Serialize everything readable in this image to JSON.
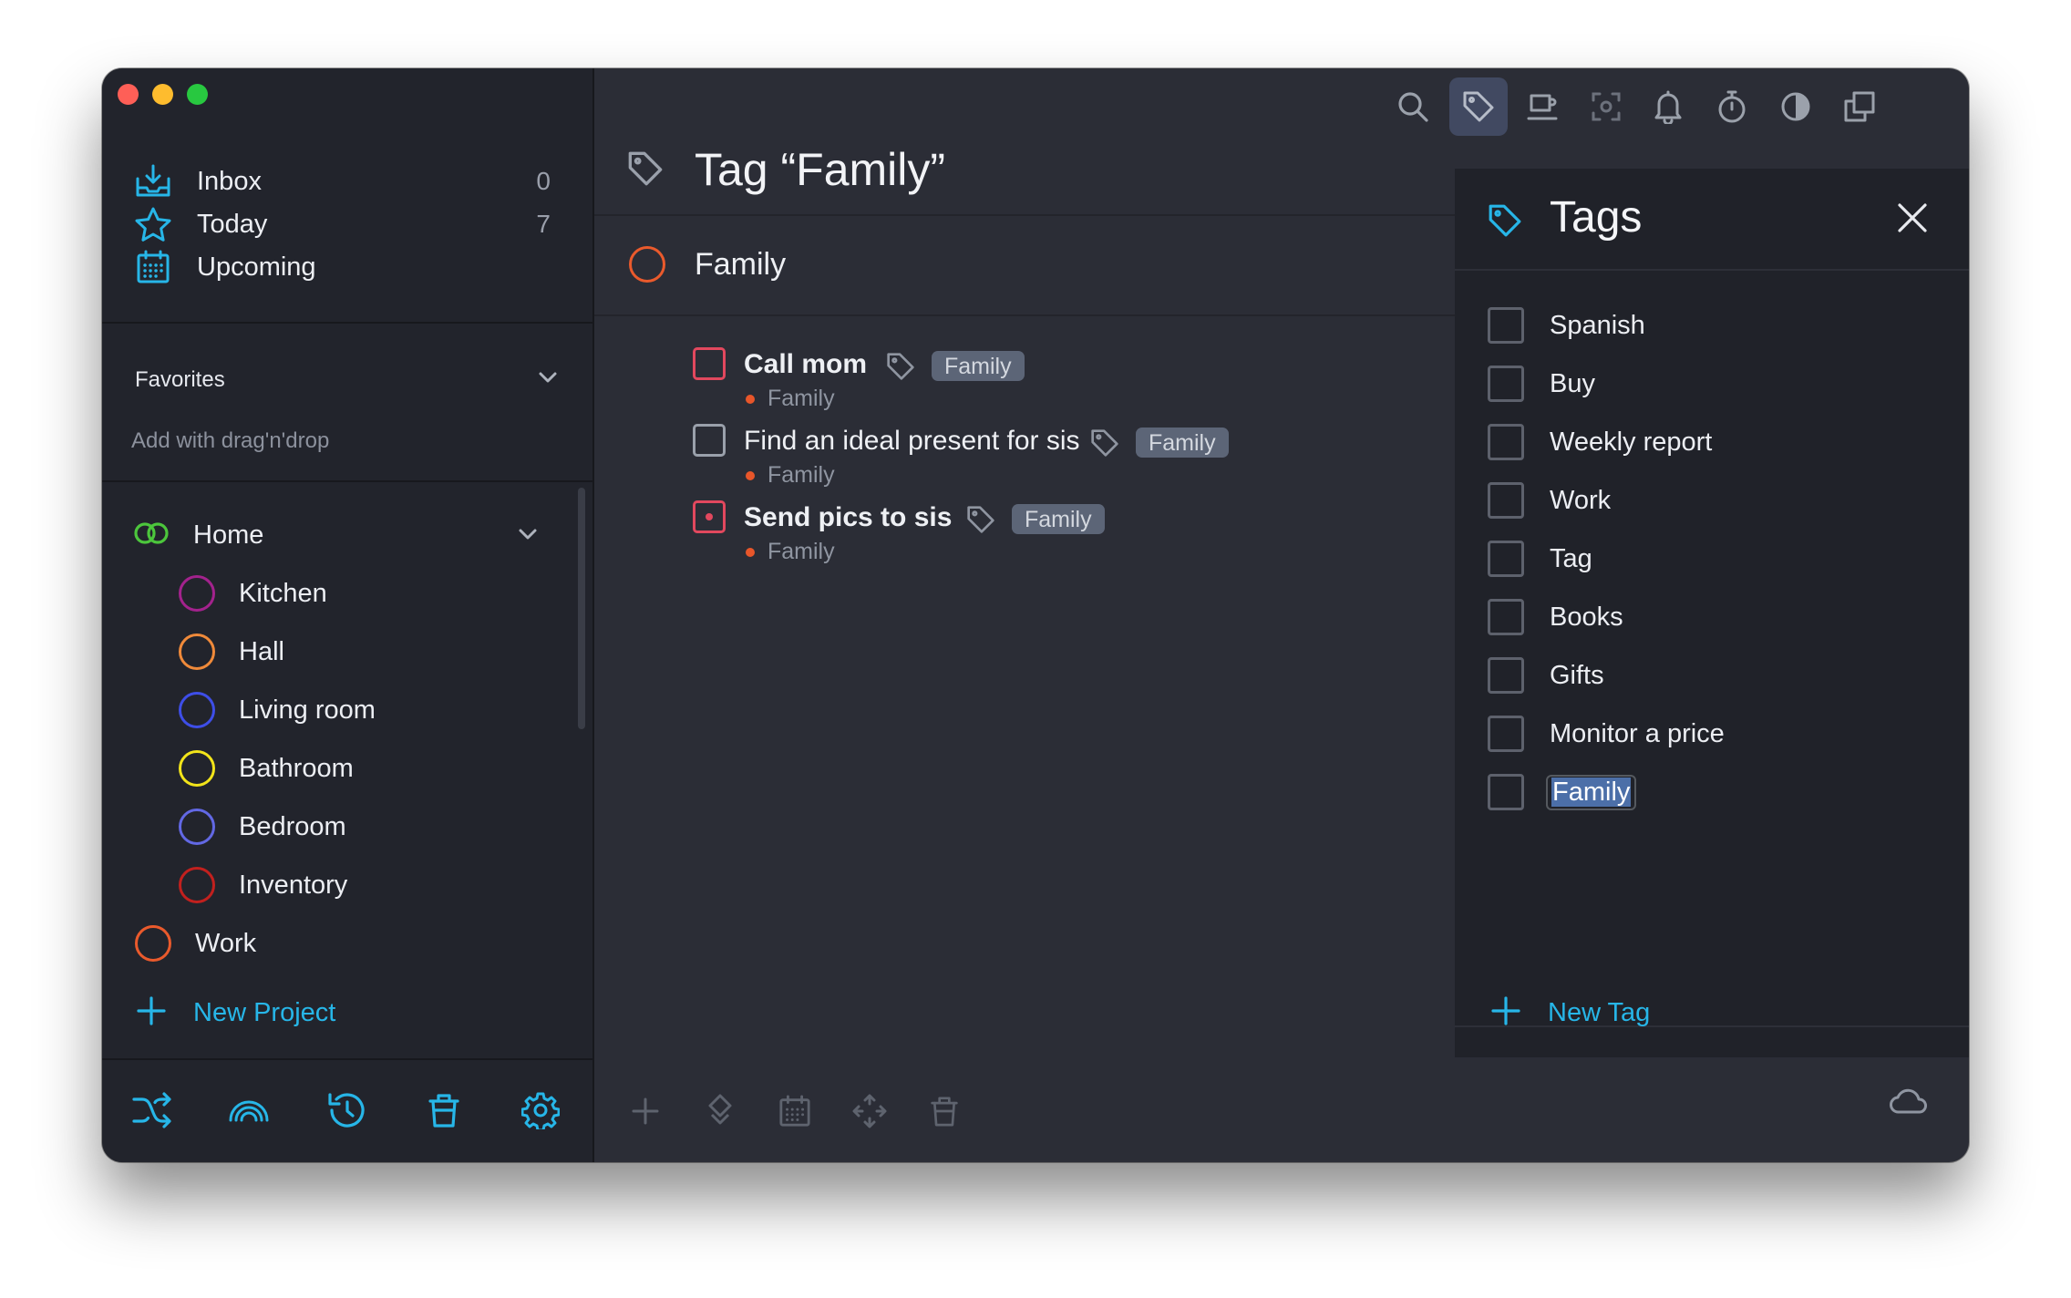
{
  "sidebar": {
    "nav": [
      {
        "label": "Inbox",
        "count": "0",
        "icon": "inbox-icon"
      },
      {
        "label": "Today",
        "count": "7",
        "icon": "star-icon"
      },
      {
        "label": "Upcoming",
        "count": "",
        "icon": "calendar-icon"
      }
    ],
    "favorites_title": "Favorites",
    "favorites_hint": "Add with drag'n'drop",
    "projects": [
      {
        "label": "Home",
        "color": "#4cc63c"
      },
      {
        "label": "Kitchen",
        "color": "#a3228d"
      },
      {
        "label": "Hall",
        "color": "#f08a3a"
      },
      {
        "label": "Living room",
        "color": "#3e4ee8"
      },
      {
        "label": "Bathroom",
        "color": "#f2e41a"
      },
      {
        "label": "Bedroom",
        "color": "#6268e4"
      },
      {
        "label": "Inventory",
        "color": "#c2201e"
      },
      {
        "label": "Work",
        "color": "#ea5a2c"
      }
    ],
    "new_project_label": "New Project",
    "accent": "#27b6e8"
  },
  "main": {
    "title": "Tag “Family”",
    "group": "Family",
    "tasks": [
      {
        "title": "Call mom",
        "project": "Family",
        "tag": "Family"
      },
      {
        "title": "Find an ideal present for sis",
        "project": "Family",
        "tag": "Family"
      },
      {
        "title": "Send pics to sis",
        "project": "Family",
        "tag": "Family"
      }
    ]
  },
  "tags_panel": {
    "title": "Tags",
    "tags": [
      "Spanish",
      "Buy",
      "Weekly report",
      "Work",
      "Tag",
      "Books",
      "Gifts",
      "Monitor a price",
      "Family"
    ],
    "new_tag_label": "New Tag"
  }
}
